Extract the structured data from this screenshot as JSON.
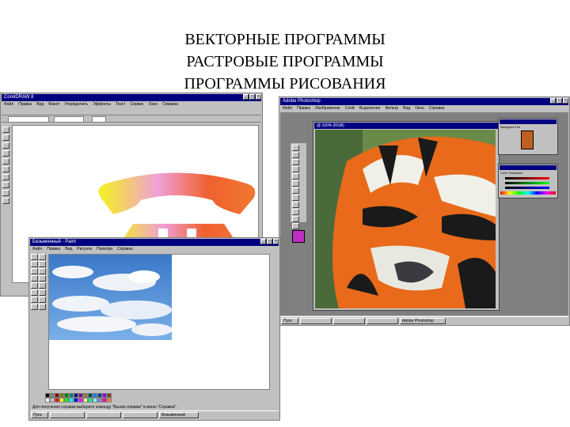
{
  "headings": [
    "ВЕКТОРНЫЕ ПРОГРАММЫ",
    "РАСТРОВЫЕ ПРОГРАММЫ",
    "ПРОГРАММЫ РИСОВАНИЯ"
  ],
  "corel": {
    "title": "CorelDRAW 8",
    "menu": [
      "Файл",
      "Правка",
      "Вид",
      "Макет",
      "Упорядочить",
      "Эффекты",
      "Текст",
      "Сервис",
      "Окно",
      "Справка"
    ]
  },
  "photoshop": {
    "title": "Adobe Photoshop",
    "doc_title": "@ 100% (RGB)",
    "menu": [
      "Файл",
      "Правка",
      "Изображение",
      "Слой",
      "Выделение",
      "Фильтр",
      "Вид",
      "Окно",
      "Справка"
    ],
    "panels": [
      "Navigator",
      "Info",
      "Color",
      "Swatches"
    ],
    "taskbar": [
      "Пуск",
      "Adobe Photoshop"
    ]
  },
  "paint": {
    "title": "Безымянный - Paint",
    "menu": [
      "Файл",
      "Правка",
      "Вид",
      "Рисунок",
      "Палитра",
      "Справка"
    ],
    "status": "Для получения справки выберите команду \"Вызов справки\" в меню \"Справка\".",
    "taskbar": [
      "Пуск",
      "",
      "",
      "",
      "Безымянный"
    ]
  },
  "colors": {
    "titlebar": "#000080",
    "chrome": "#c0c0c0",
    "gradient": [
      "#f4f11c",
      "#f0a0d8",
      "#f06030",
      "#f07830"
    ],
    "palette": [
      "#000000",
      "#808080",
      "#800000",
      "#808000",
      "#008000",
      "#008080",
      "#000080",
      "#800080",
      "#808040",
      "#004040",
      "#0080ff",
      "#004080",
      "#8000ff",
      "#804000",
      "#ffffff",
      "#c0c0c0",
      "#ff0000",
      "#ffff00",
      "#00ff00",
      "#00ffff",
      "#0000ff",
      "#ff00ff",
      "#ffff80",
      "#00ff80",
      "#80ffff",
      "#8080ff",
      "#ff0080",
      "#ff8040"
    ]
  },
  "icons": [
    "window-minimize-icon",
    "window-maximize-icon",
    "window-close-icon",
    "telephone-graphic",
    "tiger-photo",
    "sky-clouds-photo"
  ]
}
